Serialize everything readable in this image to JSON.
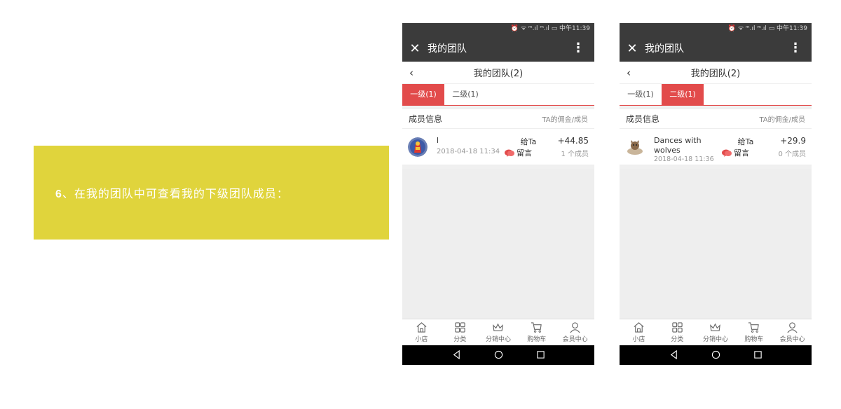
{
  "banner": {
    "step": "6",
    "text": "、在我的团队中可查看我的下级团队成员："
  },
  "phones": [
    {
      "status_text": "⏰ ᯤ ᵐ.ıl ᵐ.ıl ▭ 中午11:39",
      "wechat_title": "我的团队",
      "page_title": "我的团队(2)",
      "tabs": [
        "一级(1)",
        "二级(1)"
      ],
      "active_tab": 0,
      "member_header_left": "成员信息",
      "member_header_right": "TA的佣金/成员",
      "member": {
        "name": "l",
        "date": "2018-04-18 11:34",
        "gift": "给Ta",
        "msg": "留言",
        "amount": "+44.85",
        "count": "1 个成员"
      }
    },
    {
      "status_text": "⏰ ᯤ ᵐ.ıl ᵐ.ıl ▭ 中午11:39",
      "wechat_title": "我的团队",
      "page_title": "我的团队(2)",
      "tabs": [
        "一级(1)",
        "二级(1)"
      ],
      "active_tab": 1,
      "member_header_left": "成员信息",
      "member_header_right": "TA的佣金/成员",
      "member": {
        "name": "Dances with wolves",
        "date": "2018-04-18 11:36",
        "gift": "给Ta",
        "msg": "留言",
        "amount": "+29.9",
        "count": "0 个成员"
      }
    }
  ],
  "tabbar": [
    "小店",
    "分类",
    "分销中心",
    "购物车",
    "会员中心"
  ],
  "colors": {
    "accent": "#e24b4b",
    "banner": "#e0d43c",
    "header": "#3b3b3b"
  }
}
